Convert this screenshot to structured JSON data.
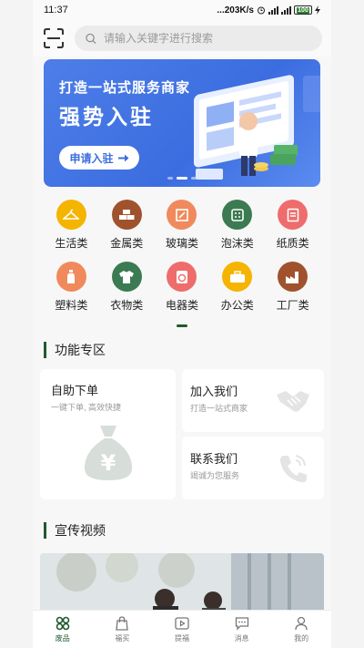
{
  "status_bar": {
    "time": "11:37",
    "network_speed": "...203K/s",
    "battery": "100"
  },
  "search": {
    "placeholder": "请输入关键字进行搜索"
  },
  "banner": {
    "line1": "打造一站式服务商家",
    "line2": "强势入驻",
    "cta_label": "申请入驻",
    "accent": "#3c6de0"
  },
  "categories": [
    {
      "label": "生活类",
      "icon": "hanger-icon",
      "color": "#f5b400"
    },
    {
      "label": "金属类",
      "icon": "metal-bars-icon",
      "color": "#a0522d"
    },
    {
      "label": "玻璃类",
      "icon": "glass-icon",
      "color": "#f08a5d"
    },
    {
      "label": "泡沫类",
      "icon": "foam-icon",
      "color": "#3c7a52"
    },
    {
      "label": "纸质类",
      "icon": "paper-icon",
      "color": "#ef6c6c"
    },
    {
      "label": "塑料类",
      "icon": "bottle-icon",
      "color": "#f08a5d"
    },
    {
      "label": "衣物类",
      "icon": "shirt-icon",
      "color": "#3c7a52"
    },
    {
      "label": "电器类",
      "icon": "washer-icon",
      "color": "#ef6c6c"
    },
    {
      "label": "办公类",
      "icon": "briefcase-icon",
      "color": "#f5b400"
    },
    {
      "label": "工厂类",
      "icon": "factory-icon",
      "color": "#a0522d"
    }
  ],
  "function_section": {
    "title": "功能专区",
    "self_order": {
      "title": "自助下单",
      "subtitle": "一键下单, 高效快捷"
    },
    "join_us": {
      "title": "加入我们",
      "subtitle": "打造一站式商家"
    },
    "contact_us": {
      "title": "联系我们",
      "subtitle": "竭诚为您服务"
    }
  },
  "video_section": {
    "title": "宣传视频"
  },
  "tabbar": [
    {
      "label": "废品",
      "icon": "home-grid-icon",
      "active": true
    },
    {
      "label": "福买",
      "icon": "shopping-bag-icon",
      "active": false
    },
    {
      "label": "提福",
      "icon": "play-icon",
      "active": false
    },
    {
      "label": "消息",
      "icon": "message-icon",
      "active": false
    },
    {
      "label": "我的",
      "icon": "user-icon",
      "active": false
    }
  ],
  "colors": {
    "brand_green": "#1f5a2e"
  }
}
